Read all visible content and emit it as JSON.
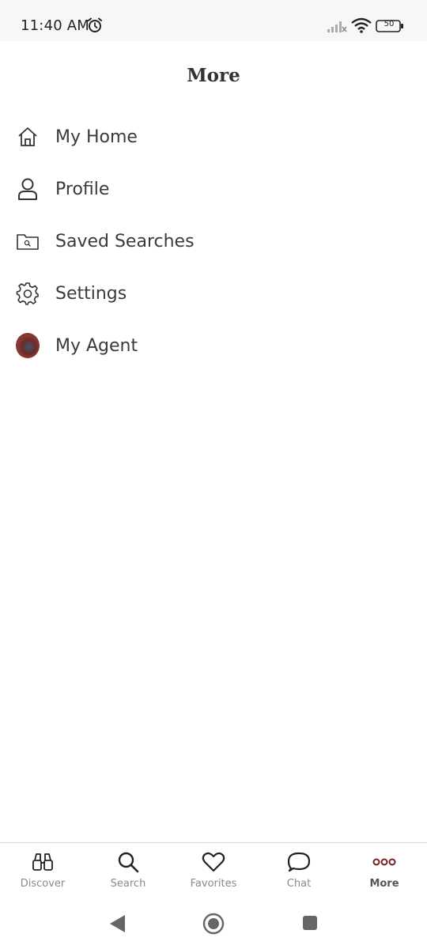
{
  "status_bar": {
    "time": "11:40 AM",
    "battery": "50",
    "icons": [
      "alarm-icon",
      "signal-icon",
      "wifi-icon",
      "battery-icon"
    ]
  },
  "header": {
    "title": "More"
  },
  "menu": {
    "items": [
      {
        "label": "My Home",
        "icon": "home-icon"
      },
      {
        "label": "Profile",
        "icon": "profile-icon"
      },
      {
        "label": "Saved Searches",
        "icon": "folder-search-icon"
      },
      {
        "label": "Settings",
        "icon": "gear-icon"
      },
      {
        "label": "My Agent",
        "icon": "agent-avatar"
      }
    ]
  },
  "tab_bar": {
    "active": "More",
    "tabs": [
      {
        "label": "Discover",
        "icon": "binoculars-icon"
      },
      {
        "label": "Search",
        "icon": "search-icon"
      },
      {
        "label": "Favorites",
        "icon": "heart-icon"
      },
      {
        "label": "Chat",
        "icon": "chat-bubble-icon"
      },
      {
        "label": "More",
        "icon": "more-dots-icon"
      }
    ],
    "accent_color": "#7a1f1f"
  },
  "system_nav": {
    "icons": [
      "back-icon",
      "home-nav-icon",
      "recents-icon"
    ]
  }
}
